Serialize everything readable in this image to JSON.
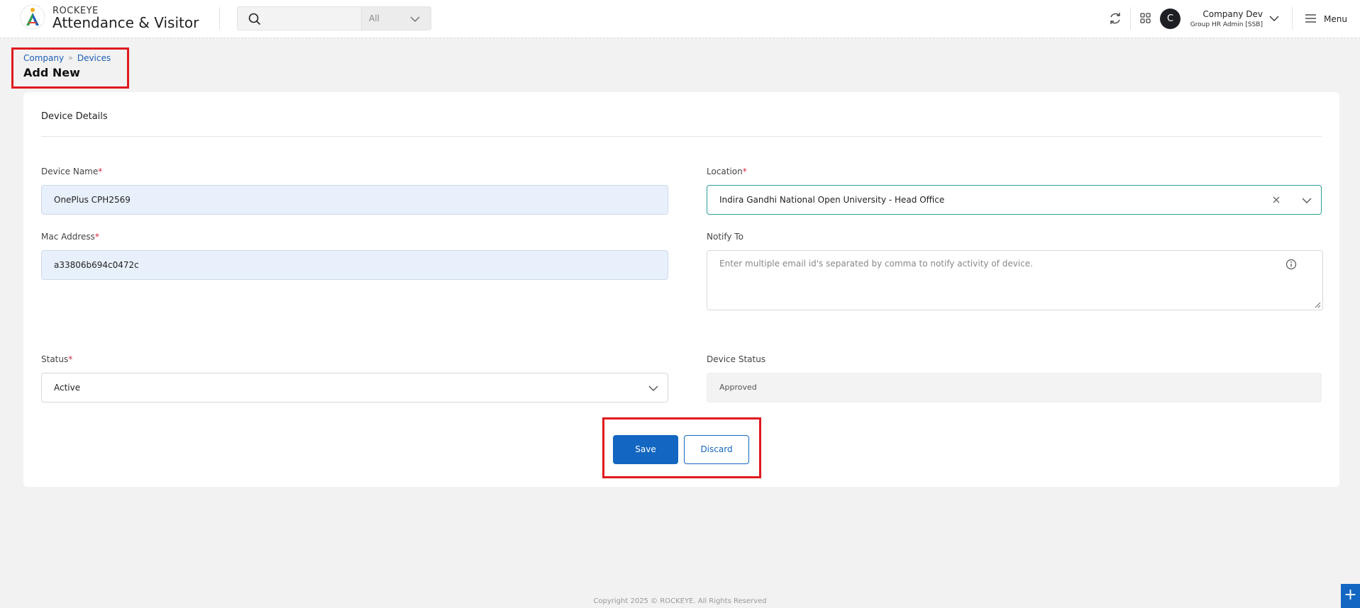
{
  "header": {
    "brand_top": "ROCKEYE",
    "brand_main": "Attendance & Visitor",
    "search": {
      "placeholder": "",
      "filter_value": "All"
    },
    "user": {
      "avatar_initial": "C",
      "name": "Company Dev",
      "role": "Group HR Admin [SSB]"
    },
    "menu_label": "Menu"
  },
  "breadcrumb": {
    "items": [
      "Company",
      "Devices"
    ]
  },
  "page_title": "Add New",
  "form": {
    "section_title": "Device Details",
    "device_name": {
      "label": "Device Name",
      "value": "OnePlus CPH2569"
    },
    "location": {
      "label": "Location",
      "value": "Indira Gandhi National Open University - Head Office"
    },
    "mac_address": {
      "label": "Mac Address",
      "value": "a33806b694c0472c"
    },
    "notify_to": {
      "label": "Notify To",
      "placeholder": "Enter multiple email id's separated by comma to notify activity of device."
    },
    "status": {
      "label": "Status",
      "value": "Active"
    },
    "device_status": {
      "label": "Device Status",
      "value": "Approved"
    },
    "required_mark": "*",
    "save_label": "Save",
    "discard_label": "Discard"
  },
  "footer": {
    "copyright": "Copyright 2025 © ROCKEYE. All Rights Reserved"
  },
  "fab_label": "+",
  "colors": {
    "primary": "#1366c1",
    "highlight": "#e0191f",
    "focus": "#2aa198"
  }
}
